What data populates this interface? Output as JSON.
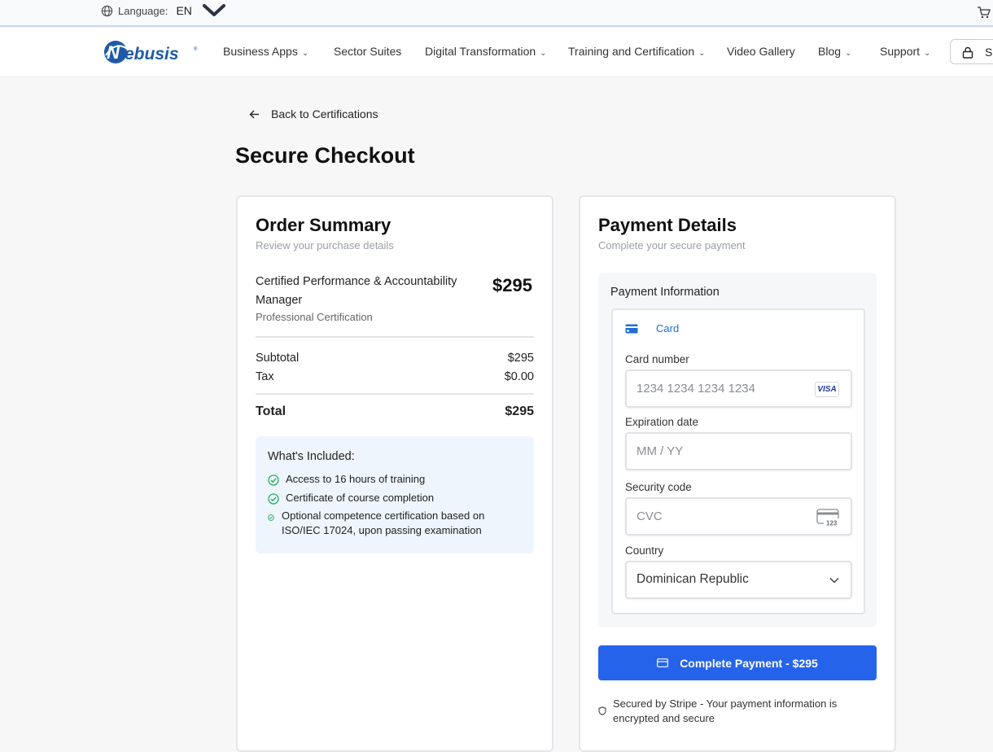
{
  "topbar": {
    "language_label": "Language:",
    "language_code": "EN"
  },
  "nav": {
    "brand": "Nebusis",
    "items": [
      {
        "label": "Business Apps",
        "dropdown": true
      },
      {
        "label": "Sector Suites",
        "dropdown": false
      },
      {
        "label": "Digital Transformation",
        "dropdown": true
      },
      {
        "label": "Training and Certification",
        "dropdown": true
      },
      {
        "label": "Video Gallery",
        "dropdown": false
      },
      {
        "label": "Blog",
        "dropdown": true
      },
      {
        "label": "Support",
        "dropdown": true
      }
    ],
    "signin_label": "S",
    "caret": "⌄"
  },
  "page": {
    "back_label": "Back to Certifications",
    "title": "Secure Checkout"
  },
  "order": {
    "title": "Order Summary",
    "subtitle": "Review your purchase details",
    "product_name": "Certified Performance & Accountability Manager",
    "product_type": "Professional Certification",
    "product_price": "$295",
    "subtotal_label": "Subtotal",
    "subtotal_value": "$295",
    "tax_label": "Tax",
    "tax_value": "$0.00",
    "total_label": "Total",
    "total_value": "$295",
    "included_title": "What's Included:",
    "included_items": [
      "Access to 16 hours of training",
      "Certificate of course completion",
      "Optional competence certification based on ISO/IEC 17024, upon passing examination"
    ]
  },
  "payment": {
    "title": "Payment Details",
    "subtitle": "Complete your secure payment",
    "info_label": "Payment Information",
    "tab_card": "Card",
    "card_number_label": "Card number",
    "card_number_placeholder": "1234 1234 1234 1234",
    "card_brand": "VISA",
    "expiry_label": "Expiration date",
    "expiry_placeholder": "MM / YY",
    "cvc_label": "Security code",
    "cvc_placeholder": "CVC",
    "cvc_hint": "123",
    "country_label": "Country",
    "country_value": "Dominican Republic",
    "button_label": "Complete Payment - $295",
    "secure_note": "Secured by Stripe - Your payment information is encrypted and secure"
  },
  "colors": {
    "accent": "#2563eb",
    "check": "#22b05a",
    "included_bg": "#eef5fd"
  }
}
